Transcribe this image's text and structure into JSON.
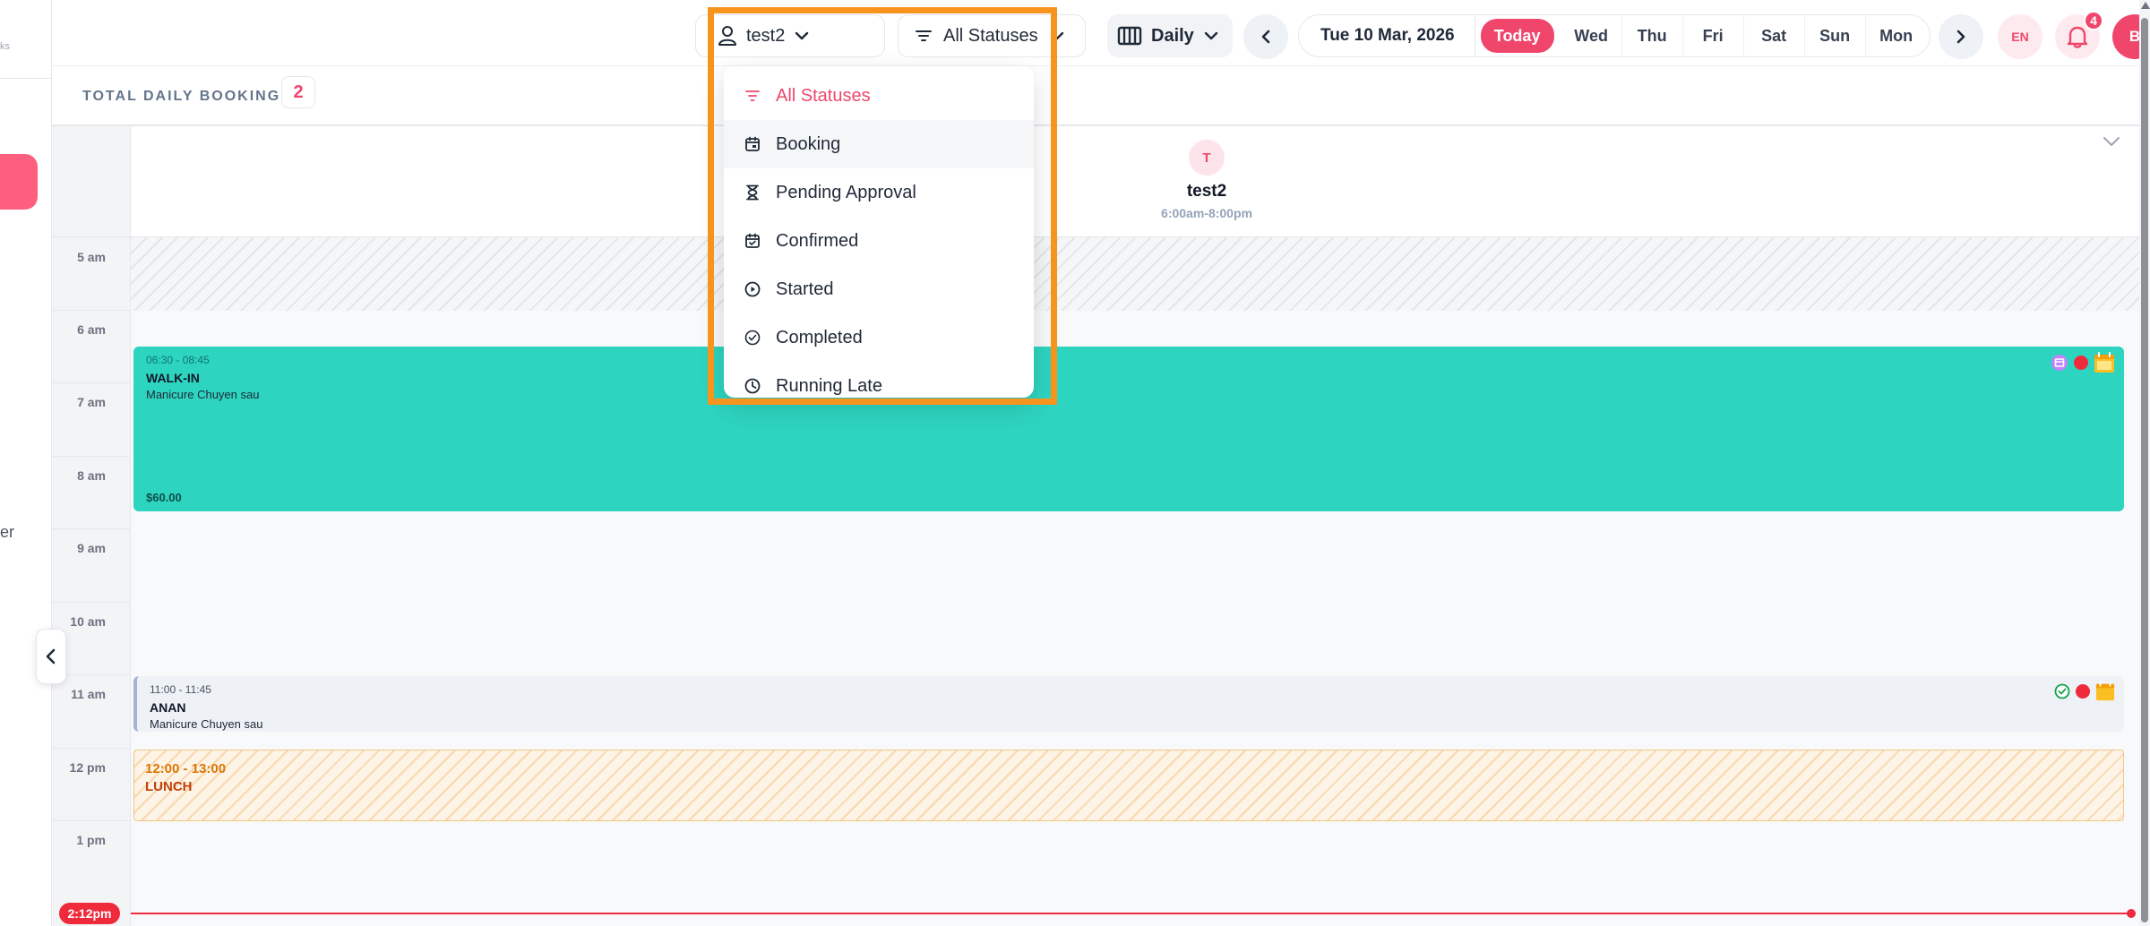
{
  "sidebar": {
    "cut_text_top": "ks",
    "cut_text_mid": "er"
  },
  "header": {
    "staff_filter": "test2",
    "status_filter": "All Statuses",
    "view_mode": "Daily",
    "current_date": "Tue 10 Mar, 2026",
    "today_label": "Today",
    "days": [
      "Wed",
      "Thu",
      "Fri",
      "Sat",
      "Sun",
      "Mon"
    ],
    "language": "EN",
    "notification_count": "4",
    "user_initial": "B"
  },
  "summary": {
    "label": "TOTAL DAILY BOOKING:",
    "count": "2"
  },
  "staff": {
    "initial": "T",
    "name": "test2",
    "hours": "6:00am-8:00pm"
  },
  "hours": [
    "5 am",
    "6 am",
    "7 am",
    "8 am",
    "9 am",
    "10 am",
    "11 am",
    "12 pm",
    "1 pm"
  ],
  "bookings": [
    {
      "time": "06:30 - 08:45",
      "name": "WALK-IN",
      "service": "Manicure Chuyen sau",
      "price": "$60.00"
    },
    {
      "time": "11:00 - 11:45",
      "name": "ANAN",
      "service": "Manicure Chuyen sau"
    }
  ],
  "lunch": {
    "time": "12:00 - 13:00",
    "label": "LUNCH"
  },
  "now_label": "2:12pm",
  "status_menu": [
    {
      "label": "All Statuses",
      "icon": "filter-icon"
    },
    {
      "label": "Booking",
      "icon": "calendar-icon"
    },
    {
      "label": "Pending Approval",
      "icon": "hourglass-icon"
    },
    {
      "label": "Confirmed",
      "icon": "calendar-check-icon"
    },
    {
      "label": "Started",
      "icon": "play-circle-icon"
    },
    {
      "label": "Completed",
      "icon": "check-circle-icon"
    },
    {
      "label": "Running Late",
      "icon": "clock-icon"
    }
  ],
  "colors": {
    "accent": "#f0466c",
    "walkin": "#2dd4bf",
    "highlight": "#f7941d",
    "now": "#ef2b3b"
  }
}
